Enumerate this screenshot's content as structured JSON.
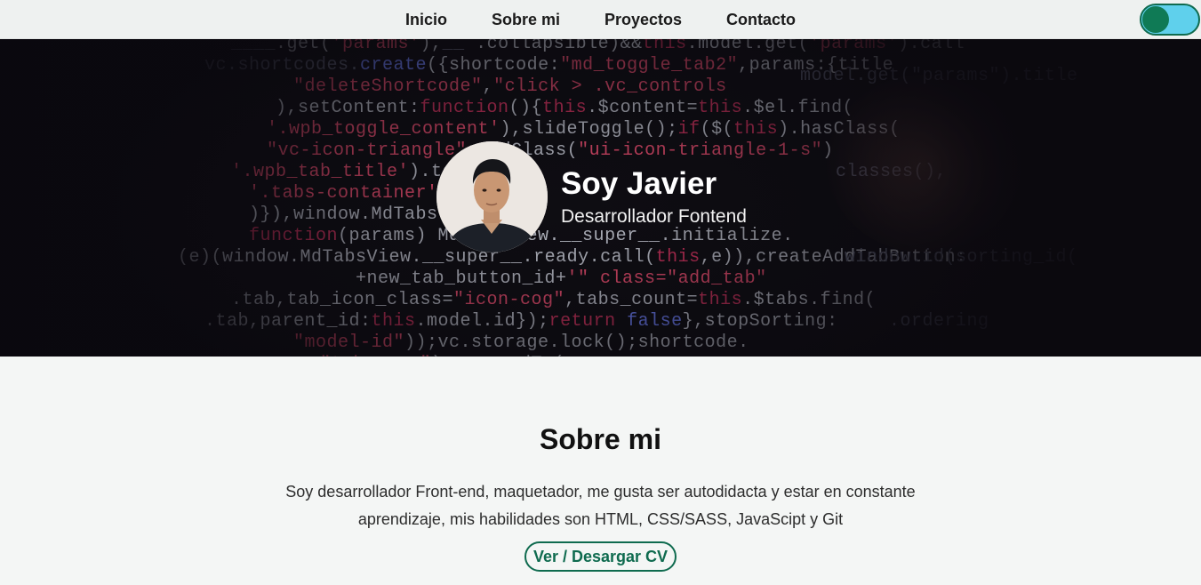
{
  "nav": {
    "items": [
      {
        "label": "Inicio"
      },
      {
        "label": "Sobre mi"
      },
      {
        "label": "Proyectos"
      },
      {
        "label": "Contacto"
      }
    ]
  },
  "hero": {
    "title": "Soy Javier",
    "subtitle": "Desarrollador Fontend"
  },
  "about": {
    "title": "Sobre mi",
    "text": "Soy desarrollador Front-end, maquetador, me gusta ser autodidacta y estar en constante aprendizaje, mis habilidades son HTML, CSS/SASS, JavaScipt y Git",
    "cv_label": "Ver / Desargar CV"
  },
  "colors": {
    "accent": "#0f6b4f",
    "toggle_track": "#5fd0ec",
    "nav_bg": "#eef1f0",
    "page_bg": "#f4f6f5"
  },
  "icons": {
    "theme_toggle": "theme-toggle-switch"
  }
}
